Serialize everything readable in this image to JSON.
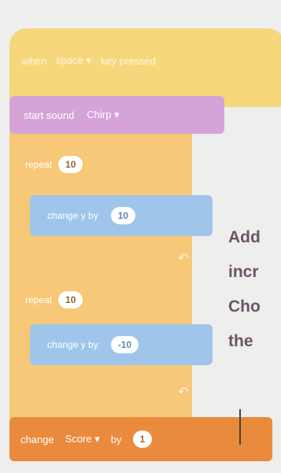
{
  "event": {
    "label": "when",
    "key": "space",
    "suffix": "key pressed"
  },
  "sound": {
    "label": "start sound",
    "value": "Chirp"
  },
  "repeat1": {
    "label": "repeat",
    "value": "10",
    "motion": {
      "label": "change y by",
      "value": "10"
    }
  },
  "repeat2": {
    "label": "repeat",
    "value": "10",
    "motion": {
      "label": "change y by",
      "value": "-10"
    }
  },
  "variable": {
    "label": "change",
    "var": "Score",
    "by": "by",
    "value": "1"
  },
  "annotation": {
    "line1": "Add",
    "line2": "incr",
    "line3": "Cho",
    "line4": "the"
  },
  "colors": {
    "events": "#f6d77c",
    "sound": "#d6a3d9",
    "control": "#f7c878",
    "motion": "#9fc6ea",
    "variables": "#ea8a3c"
  }
}
